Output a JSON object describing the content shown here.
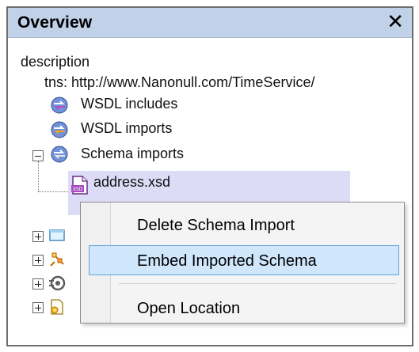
{
  "panel": {
    "title": "Overview",
    "close_label": "✕"
  },
  "tree": {
    "description_label": "description",
    "tns_label": "tns:  http://www.Nanonull.com/TimeService/",
    "items": [
      {
        "label": "WSDL includes",
        "icon": "wsdl-includes-icon"
      },
      {
        "label": "WSDL imports",
        "icon": "wsdl-imports-icon"
      },
      {
        "label": "Schema imports",
        "icon": "schema-imports-icon"
      }
    ],
    "selected_child": {
      "label": "address.xsd",
      "icon": "xsd-file-icon"
    },
    "collapsed_icons": [
      "messages-icon",
      "port-types-icon",
      "bindings-icon",
      "services-icon"
    ]
  },
  "context_menu": {
    "items": [
      {
        "label": "Delete Schema Import",
        "highlighted": false
      },
      {
        "label": "Embed Imported Schema",
        "highlighted": true
      },
      {
        "label": "Open Location",
        "highlighted": false
      }
    ]
  },
  "colors": {
    "titlebar": "#c0d1e8",
    "selection": "#dcdcf6",
    "menu_highlight": "#cfe6fb",
    "menu_highlight_border": "#63a5dc"
  }
}
